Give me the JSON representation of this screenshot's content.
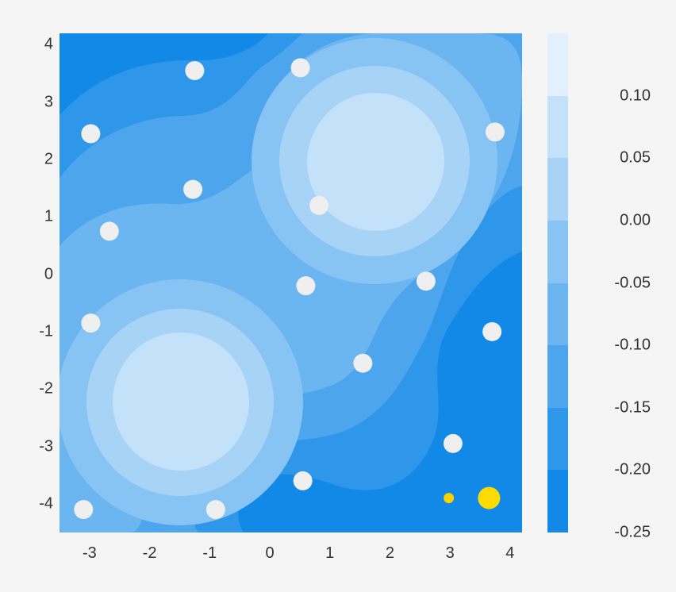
{
  "chart_data": {
    "type": "scatter",
    "title": "",
    "xlabel": "",
    "ylabel": "",
    "xlim": [
      -3.5,
      4.2
    ],
    "ylim": [
      -4.5,
      4.2
    ],
    "x_ticks": [
      -3,
      -2,
      -1,
      0,
      1,
      2,
      3,
      4
    ],
    "y_ticks": [
      -4,
      -3,
      -2,
      -1,
      0,
      1,
      2,
      3,
      4
    ],
    "contour_levels": [
      0.1,
      0.05,
      0.0,
      -0.05,
      -0.1,
      -0.15,
      -0.2,
      -0.25
    ],
    "contour_colors": [
      "#E1F0FC",
      "#C3E1F9",
      "#A6D3F6",
      "#88C4F3",
      "#6BB5F0",
      "#4DA6ED",
      "#2F97EA",
      "#1288E7"
    ],
    "contour_centers": [
      {
        "x": 1.75,
        "y": 2.0
      },
      {
        "x": -1.5,
        "y": -2.2
      }
    ],
    "series": [
      {
        "name": "white-points",
        "color": "#EFEFEF",
        "points": [
          {
            "x": -1.25,
            "y": 3.55
          },
          {
            "x": 0.51,
            "y": 3.6
          },
          {
            "x": 3.75,
            "y": 2.48
          },
          {
            "x": -2.98,
            "y": 2.45
          },
          {
            "x": -1.28,
            "y": 1.48
          },
          {
            "x": 0.82,
            "y": 1.2
          },
          {
            "x": -2.67,
            "y": 0.75
          },
          {
            "x": 2.6,
            "y": -0.12
          },
          {
            "x": 0.6,
            "y": -0.2
          },
          {
            "x": -2.98,
            "y": -0.85
          },
          {
            "x": 3.7,
            "y": -1.0
          },
          {
            "x": 1.55,
            "y": -1.55
          },
          {
            "x": 3.05,
            "y": -2.95
          },
          {
            "x": 0.55,
            "y": -3.6
          },
          {
            "x": -3.1,
            "y": -4.1
          },
          {
            "x": -0.9,
            "y": -4.1
          }
        ]
      },
      {
        "name": "yellow-small",
        "color": "#F7D200",
        "points": [
          {
            "x": 2.98,
            "y": -3.9
          }
        ]
      },
      {
        "name": "yellow-big",
        "color": "#FCDB00",
        "points": [
          {
            "x": 3.65,
            "y": -3.9
          }
        ]
      }
    ],
    "colorbar": {
      "labels": [
        "0.10",
        "0.05",
        "0.00",
        "-0.05",
        "-0.10",
        "-0.15",
        "-0.20",
        "-0.25"
      ]
    }
  }
}
